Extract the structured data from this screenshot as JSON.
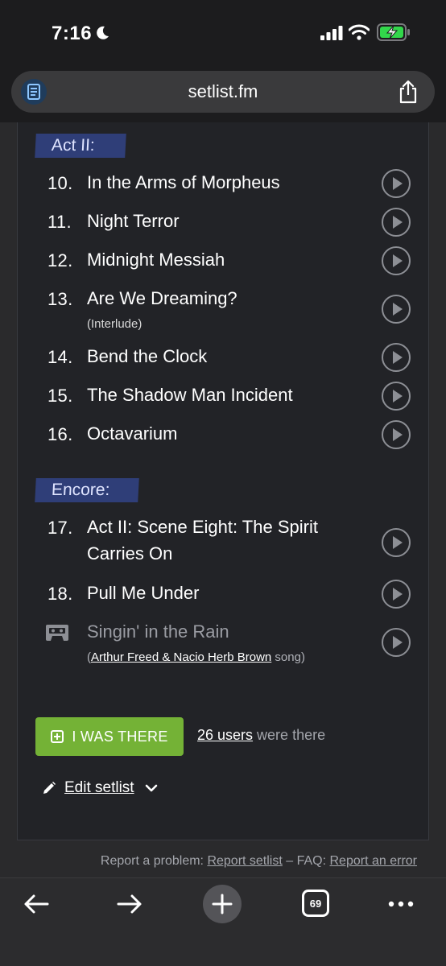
{
  "status": {
    "time": "7:16"
  },
  "browser": {
    "url": "setlist.fm",
    "tab_count": "69"
  },
  "setlist": {
    "act2_label": "Act II:",
    "encore_label": "Encore:",
    "songs": [
      {
        "num": "10.",
        "title": "In the Arms of Morpheus"
      },
      {
        "num": "11.",
        "title": "Night Terror"
      },
      {
        "num": "12.",
        "title": "Midnight Messiah"
      },
      {
        "num": "13.",
        "title": "Are We Dreaming?",
        "note": "(Interlude)"
      },
      {
        "num": "14.",
        "title": "Bend the Clock"
      },
      {
        "num": "15.",
        "title": "The Shadow Man Incident"
      },
      {
        "num": "16.",
        "title": "Octavarium"
      },
      {
        "num": "17.",
        "title": "Act II: Scene Eight: The Spirit Carries On"
      },
      {
        "num": "18.",
        "title": "Pull Me Under"
      }
    ],
    "tape": {
      "title": "Singin' in the Rain",
      "open": "(",
      "artist": "Arthur Freed & Nacio Herb Brown",
      "suffix": " song)"
    }
  },
  "actions": {
    "i_was_there": "I WAS THERE",
    "users_link": "26 users",
    "users_suffix": " were there",
    "edit_setlist": "Edit setlist"
  },
  "footer": {
    "report_prefix": "Report a problem: ",
    "report_setlist": "Report setlist",
    "faq_prefix": " – FAQ: ",
    "report_error": "Report an error"
  },
  "colors": {
    "accent_green": "#74b236",
    "section_label": "#2f3e78"
  }
}
